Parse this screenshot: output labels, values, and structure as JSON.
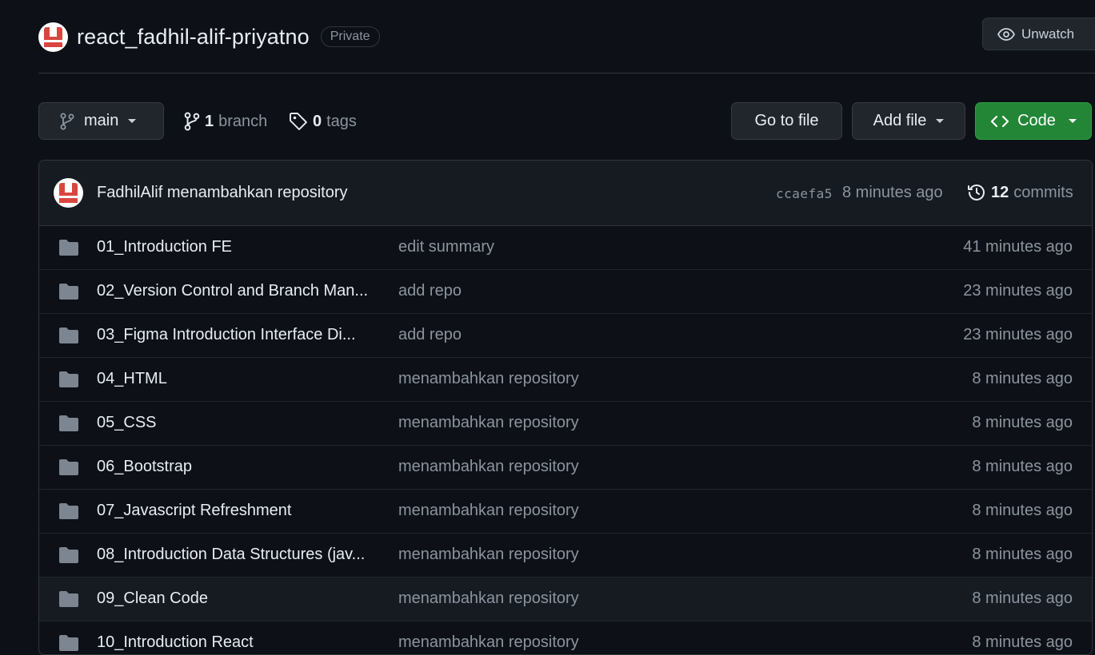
{
  "repo": {
    "name": "react_fadhil-alif-priyatno",
    "visibility": "Private",
    "watch_label": "Unwatch"
  },
  "toolbar": {
    "branch": "main",
    "branch_count": "1",
    "branch_label": "branch",
    "tag_count": "0",
    "tag_label": "tags",
    "go_to_file": "Go to file",
    "add_file": "Add file",
    "code": "Code"
  },
  "latest_commit": {
    "author": "FadhilAlif",
    "message": "menambahkan repository",
    "sha": "ccaefa5",
    "time": "8 minutes ago",
    "commit_count": "12",
    "commit_label": "commits"
  },
  "files": [
    {
      "name": "01_Introduction FE",
      "message": "edit summary",
      "time": "41 minutes ago"
    },
    {
      "name": "02_Version Control and Branch Man...",
      "message": "add repo",
      "time": "23 minutes ago"
    },
    {
      "name": "03_Figma Introduction Interface Di...",
      "message": "add repo",
      "time": "23 minutes ago"
    },
    {
      "name": "04_HTML",
      "message": "menambahkan repository",
      "time": "8 minutes ago"
    },
    {
      "name": "05_CSS",
      "message": "menambahkan repository",
      "time": "8 minutes ago"
    },
    {
      "name": "06_Bootstrap",
      "message": "menambahkan repository",
      "time": "8 minutes ago"
    },
    {
      "name": "07_Javascript Refreshment",
      "message": "menambahkan repository",
      "time": "8 minutes ago"
    },
    {
      "name": "08_Introduction Data Structures (jav...",
      "message": "menambahkan repository",
      "time": "8 minutes ago"
    },
    {
      "name": "09_Clean Code",
      "message": "menambahkan repository",
      "time": "8 minutes ago"
    },
    {
      "name": "10_Introduction React",
      "message": "menambahkan repository",
      "time": "8 minutes ago"
    }
  ],
  "colors": {
    "background": "#0d1117",
    "code_button": "#238636",
    "avatar_red": "#d9463e"
  }
}
